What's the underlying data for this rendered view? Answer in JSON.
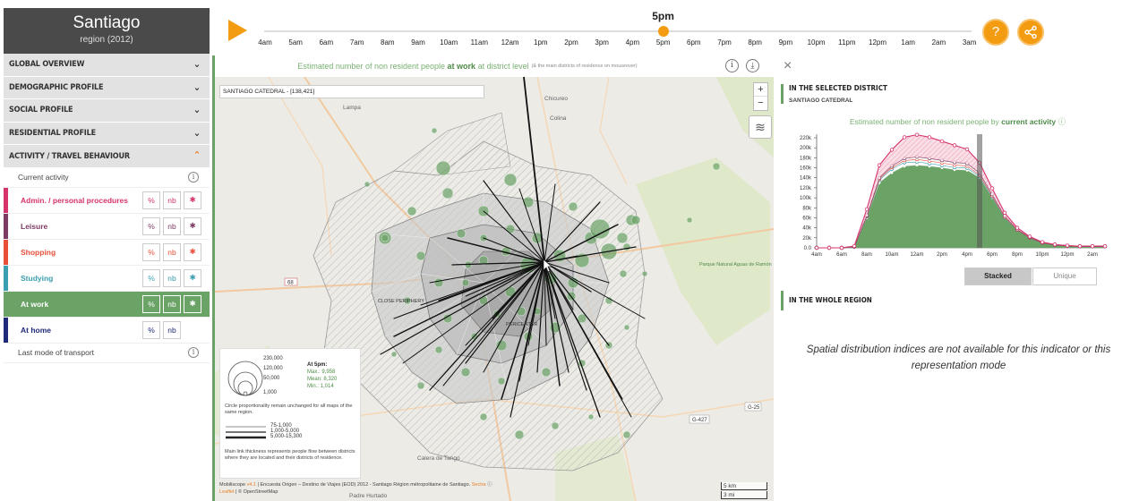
{
  "sidebar": {
    "city": "Santiago",
    "region": "region (2012)",
    "sections": [
      {
        "label": "GLOBAL OVERVIEW"
      },
      {
        "label": "DEMOGRAPHIC PROFILE"
      },
      {
        "label": "SOCIAL PROFILE"
      },
      {
        "label": "RESIDENTIAL PROFILE"
      },
      {
        "label": "ACTIVITY / TRAVEL BEHAVIOUR"
      }
    ],
    "current_activity_label": "Current activity",
    "activities": [
      {
        "label": "Admin. / personal procedures",
        "color": "#d6336c",
        "pct": "%",
        "nb": "nb",
        "star": "✱"
      },
      {
        "label": "Leisure",
        "color": "#7d3b63",
        "pct": "%",
        "nb": "nb",
        "star": "✱"
      },
      {
        "label": "Shopping",
        "color": "#e8503a",
        "pct": "%",
        "nb": "nb",
        "star": "✱"
      },
      {
        "label": "Studying",
        "color": "#3a9fb0",
        "pct": "%",
        "nb": "nb",
        "star": "✱"
      },
      {
        "label": "At work",
        "color": "#6aa365",
        "pct": "%",
        "nb": "nb",
        "star": "✱"
      },
      {
        "label": "At home",
        "color": "#1f2a78",
        "pct": "%",
        "nb": "nb"
      }
    ],
    "last_mode_label": "Last mode of transport"
  },
  "timeline": {
    "current": "5pm",
    "current_index": 13,
    "hours": [
      "4am",
      "5am",
      "6am",
      "7am",
      "8am",
      "9am",
      "10am",
      "11am",
      "12am",
      "1pm",
      "2pm",
      "3pm",
      "4pm",
      "5pm",
      "6pm",
      "7pm",
      "8pm",
      "9pm",
      "10pm",
      "11pm",
      "12pm",
      "1am",
      "2am",
      "3am"
    ],
    "help_icon": "?",
    "share_icon": "share"
  },
  "map": {
    "header_pre": "Estimated number of non resident people",
    "header_bold": "at work",
    "header_post": "at district level",
    "header_note": "(& the main districts of residence on mouseover)",
    "info_icon": "i",
    "download_icon": "⤓",
    "district_tag": "SANTIAGO CATEDRAL - [138,421]",
    "zoom_in": "+",
    "zoom_out": "−",
    "layers_icon": "≋",
    "places": [
      "Lampa",
      "Chicureo",
      "Colina",
      "CLOSE PERIPHERY",
      "PERICENTER",
      "Parque Natural Aguas de Ramón",
      "Calera de Tango",
      "Padre Hurtado",
      "G-427",
      "G-25",
      "68",
      "78"
    ],
    "legend": {
      "sizes": [
        "230,000",
        "120,000",
        "50,000",
        "1,000"
      ],
      "at_label": "At 5pm:",
      "max": "Max.: 9,958",
      "mean": "Mean: 8,320",
      "min": "Min.: 1,014",
      "circle_note": "Circle proportionality remain unchanged for all maps of the same region.",
      "links": [
        "75-1,000",
        "1,000-5,000",
        "5,000-15,300"
      ],
      "link_note": "Main link thickness represents people flow between districts where they are located and their districts of residence."
    },
    "attribution_1": "Mobiliscope",
    "attribution_ver": "v4.1",
    "attribution_2": "| Encuesta Origen – Destino de Viajes (EOD) 2012 - Santiago Région métropolitaine de Santiago.",
    "attribution_sectra": "Sectra",
    "attribution_leaflet": "Leaflet",
    "attribution_osm": "| © OpenStreetMap",
    "scale_km": "5 km",
    "scale_mi": "3 mi"
  },
  "right_panel": {
    "close_icon": "×",
    "selected_heading": "IN THE SELECTED DISTRICT",
    "district_name": "SANTIAGO CATEDRAL",
    "chart_title_pre": "Estimated number of non resident people by",
    "chart_title_bold": "current activity",
    "toggle_stacked": "Stacked",
    "toggle_unique": "Unique",
    "whole_heading": "IN THE WHOLE REGION",
    "spatial_note": "Spatial distribution indices are not available for this indicator or this representation mode"
  },
  "chart_data": {
    "type": "area",
    "x": [
      "4am",
      "5am",
      "6am",
      "7am",
      "8am",
      "9am",
      "10am",
      "11am",
      "12am",
      "1pm",
      "2pm",
      "3pm",
      "4pm",
      "5pm",
      "6pm",
      "7pm",
      "8pm",
      "9pm",
      "10pm",
      "11pm",
      "12pm",
      "1am",
      "2am",
      "3am"
    ],
    "x_tick_labels": [
      "4am",
      "6am",
      "8am",
      "10am",
      "12am",
      "2pm",
      "4pm",
      "6pm",
      "8pm",
      "10pm",
      "12pm",
      "2am"
    ],
    "y_tick_labels": [
      "0.0",
      "20k",
      "40k",
      "60k",
      "80k",
      "100k",
      "120k",
      "140k",
      "160k",
      "180k",
      "200k",
      "220k"
    ],
    "ylim": [
      0,
      220000
    ],
    "stacked": true,
    "highlight_x": "5pm",
    "series": [
      {
        "color": "#6aa365",
        "values": [
          0,
          0,
          0,
          2000,
          60000,
          130000,
          150000,
          163000,
          165000,
          163000,
          160000,
          156000,
          155000,
          140000,
          100000,
          60000,
          35000,
          20000,
          10000,
          6000,
          4000,
          3000,
          3000,
          3000
        ]
      },
      {
        "color": "#3a9fb0",
        "values": [
          0,
          0,
          0,
          300,
          3000,
          6000,
          8000,
          8000,
          7000,
          6000,
          5000,
          5000,
          5000,
          3000,
          2000,
          1000,
          500,
          300,
          200,
          100,
          0,
          0,
          0,
          0
        ]
      },
      {
        "color": "#e8503a",
        "values": [
          0,
          0,
          0,
          100,
          1000,
          2000,
          3000,
          4000,
          5000,
          5000,
          5000,
          5000,
          4000,
          3000,
          2000,
          1000,
          500,
          200,
          100,
          0,
          0,
          0,
          0,
          0
        ]
      },
      {
        "color": "#7d3b63",
        "values": [
          0,
          0,
          0,
          100,
          1000,
          2000,
          3000,
          4000,
          5000,
          5000,
          5000,
          5000,
          5000,
          4000,
          3000,
          2000,
          1000,
          500,
          200,
          100,
          100,
          100,
          0,
          0
        ]
      },
      {
        "color": "#d6336c",
        "values": [
          0,
          0,
          0,
          1000,
          12000,
          25000,
          32000,
          42000,
          44000,
          42000,
          38000,
          34000,
          28000,
          20000,
          12000,
          6000,
          3000,
          1500,
          800,
          500,
          300,
          200,
          200,
          200
        ]
      }
    ]
  }
}
